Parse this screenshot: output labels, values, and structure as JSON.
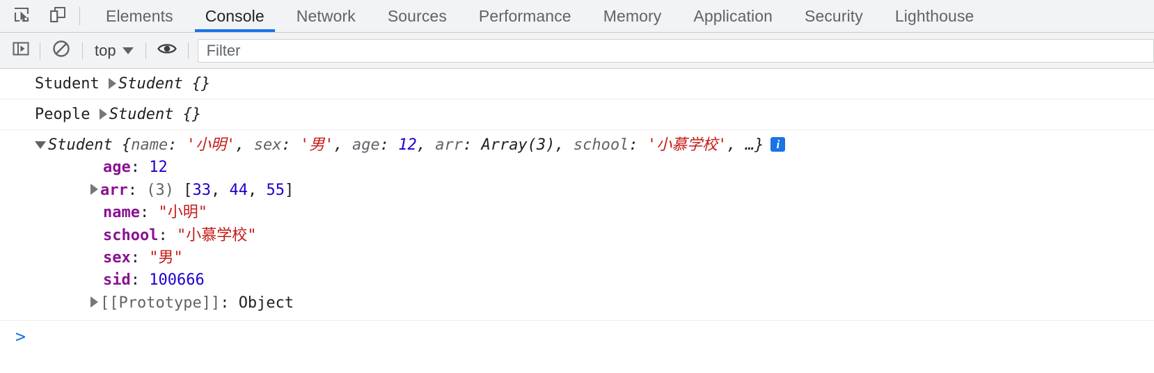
{
  "devtools": {
    "tabs": [
      {
        "label": "Elements",
        "active": false
      },
      {
        "label": "Console",
        "active": true
      },
      {
        "label": "Network",
        "active": false
      },
      {
        "label": "Sources",
        "active": false
      },
      {
        "label": "Performance",
        "active": false
      },
      {
        "label": "Memory",
        "active": false
      },
      {
        "label": "Application",
        "active": false
      },
      {
        "label": "Security",
        "active": false
      },
      {
        "label": "Lighthouse",
        "active": false
      }
    ],
    "icons": {
      "inspect": "inspect-element-icon",
      "device": "device-toolbar-icon"
    }
  },
  "console_toolbar": {
    "sidebar_toggle": "console-sidebar-icon",
    "clear": "clear-console-icon",
    "context": "top",
    "eye": "live-expression-icon",
    "filter_placeholder": "Filter",
    "filter_value": ""
  },
  "console_logs": [
    {
      "label": "Student",
      "preview": "Student {}",
      "collapsed": true
    },
    {
      "label": "People",
      "preview": "Student {}",
      "collapsed": true
    }
  ],
  "expanded_object": {
    "constructor": "Student",
    "preview_parts": [
      {
        "text": "{",
        "type": "punct"
      },
      {
        "text": "name",
        "type": "key"
      },
      {
        "text": ": ",
        "type": "punct"
      },
      {
        "text": "'小明'",
        "type": "string"
      },
      {
        "text": ", ",
        "type": "punct"
      },
      {
        "text": "sex",
        "type": "key"
      },
      {
        "text": ": ",
        "type": "punct"
      },
      {
        "text": "'男'",
        "type": "string"
      },
      {
        "text": ", ",
        "type": "punct"
      },
      {
        "text": "age",
        "type": "key"
      },
      {
        "text": ": ",
        "type": "punct"
      },
      {
        "text": "12",
        "type": "number"
      },
      {
        "text": ", ",
        "type": "punct"
      },
      {
        "text": "arr",
        "type": "key"
      },
      {
        "text": ": ",
        "type": "punct"
      },
      {
        "text": "Array(3)",
        "type": "punct"
      },
      {
        "text": ", ",
        "type": "punct"
      },
      {
        "text": "school",
        "type": "key"
      },
      {
        "text": ": ",
        "type": "punct"
      },
      {
        "text": "'小慕学校'",
        "type": "string"
      },
      {
        "text": ", …}",
        "type": "punct"
      }
    ],
    "info_badge": "i",
    "properties": [
      {
        "name": "age",
        "value": "12",
        "type": "number",
        "expandable": false
      },
      {
        "name": "arr",
        "value": "(3) [33, 44, 55]",
        "type": "array",
        "expandable": true,
        "array_count": "(3)",
        "array_items": [
          "33",
          "44",
          "55"
        ]
      },
      {
        "name": "name",
        "value": "\"小明\"",
        "type": "string",
        "expandable": false
      },
      {
        "name": "school",
        "value": "\"小慕学校\"",
        "type": "string",
        "expandable": false
      },
      {
        "name": "sex",
        "value": "\"男\"",
        "type": "string",
        "expandable": false
      },
      {
        "name": "sid",
        "value": "100666",
        "type": "number",
        "expandable": false
      }
    ],
    "prototype": {
      "label": "[[Prototype]]",
      "value": "Object",
      "expandable": true
    }
  },
  "prompt": {
    "chevron": ">",
    "value": ""
  },
  "colors": {
    "accent": "#1a73e8",
    "string": "#c41a16",
    "number": "#1c00cf",
    "property_key": "#881391",
    "toolbar_bg": "#f1f3f4"
  }
}
